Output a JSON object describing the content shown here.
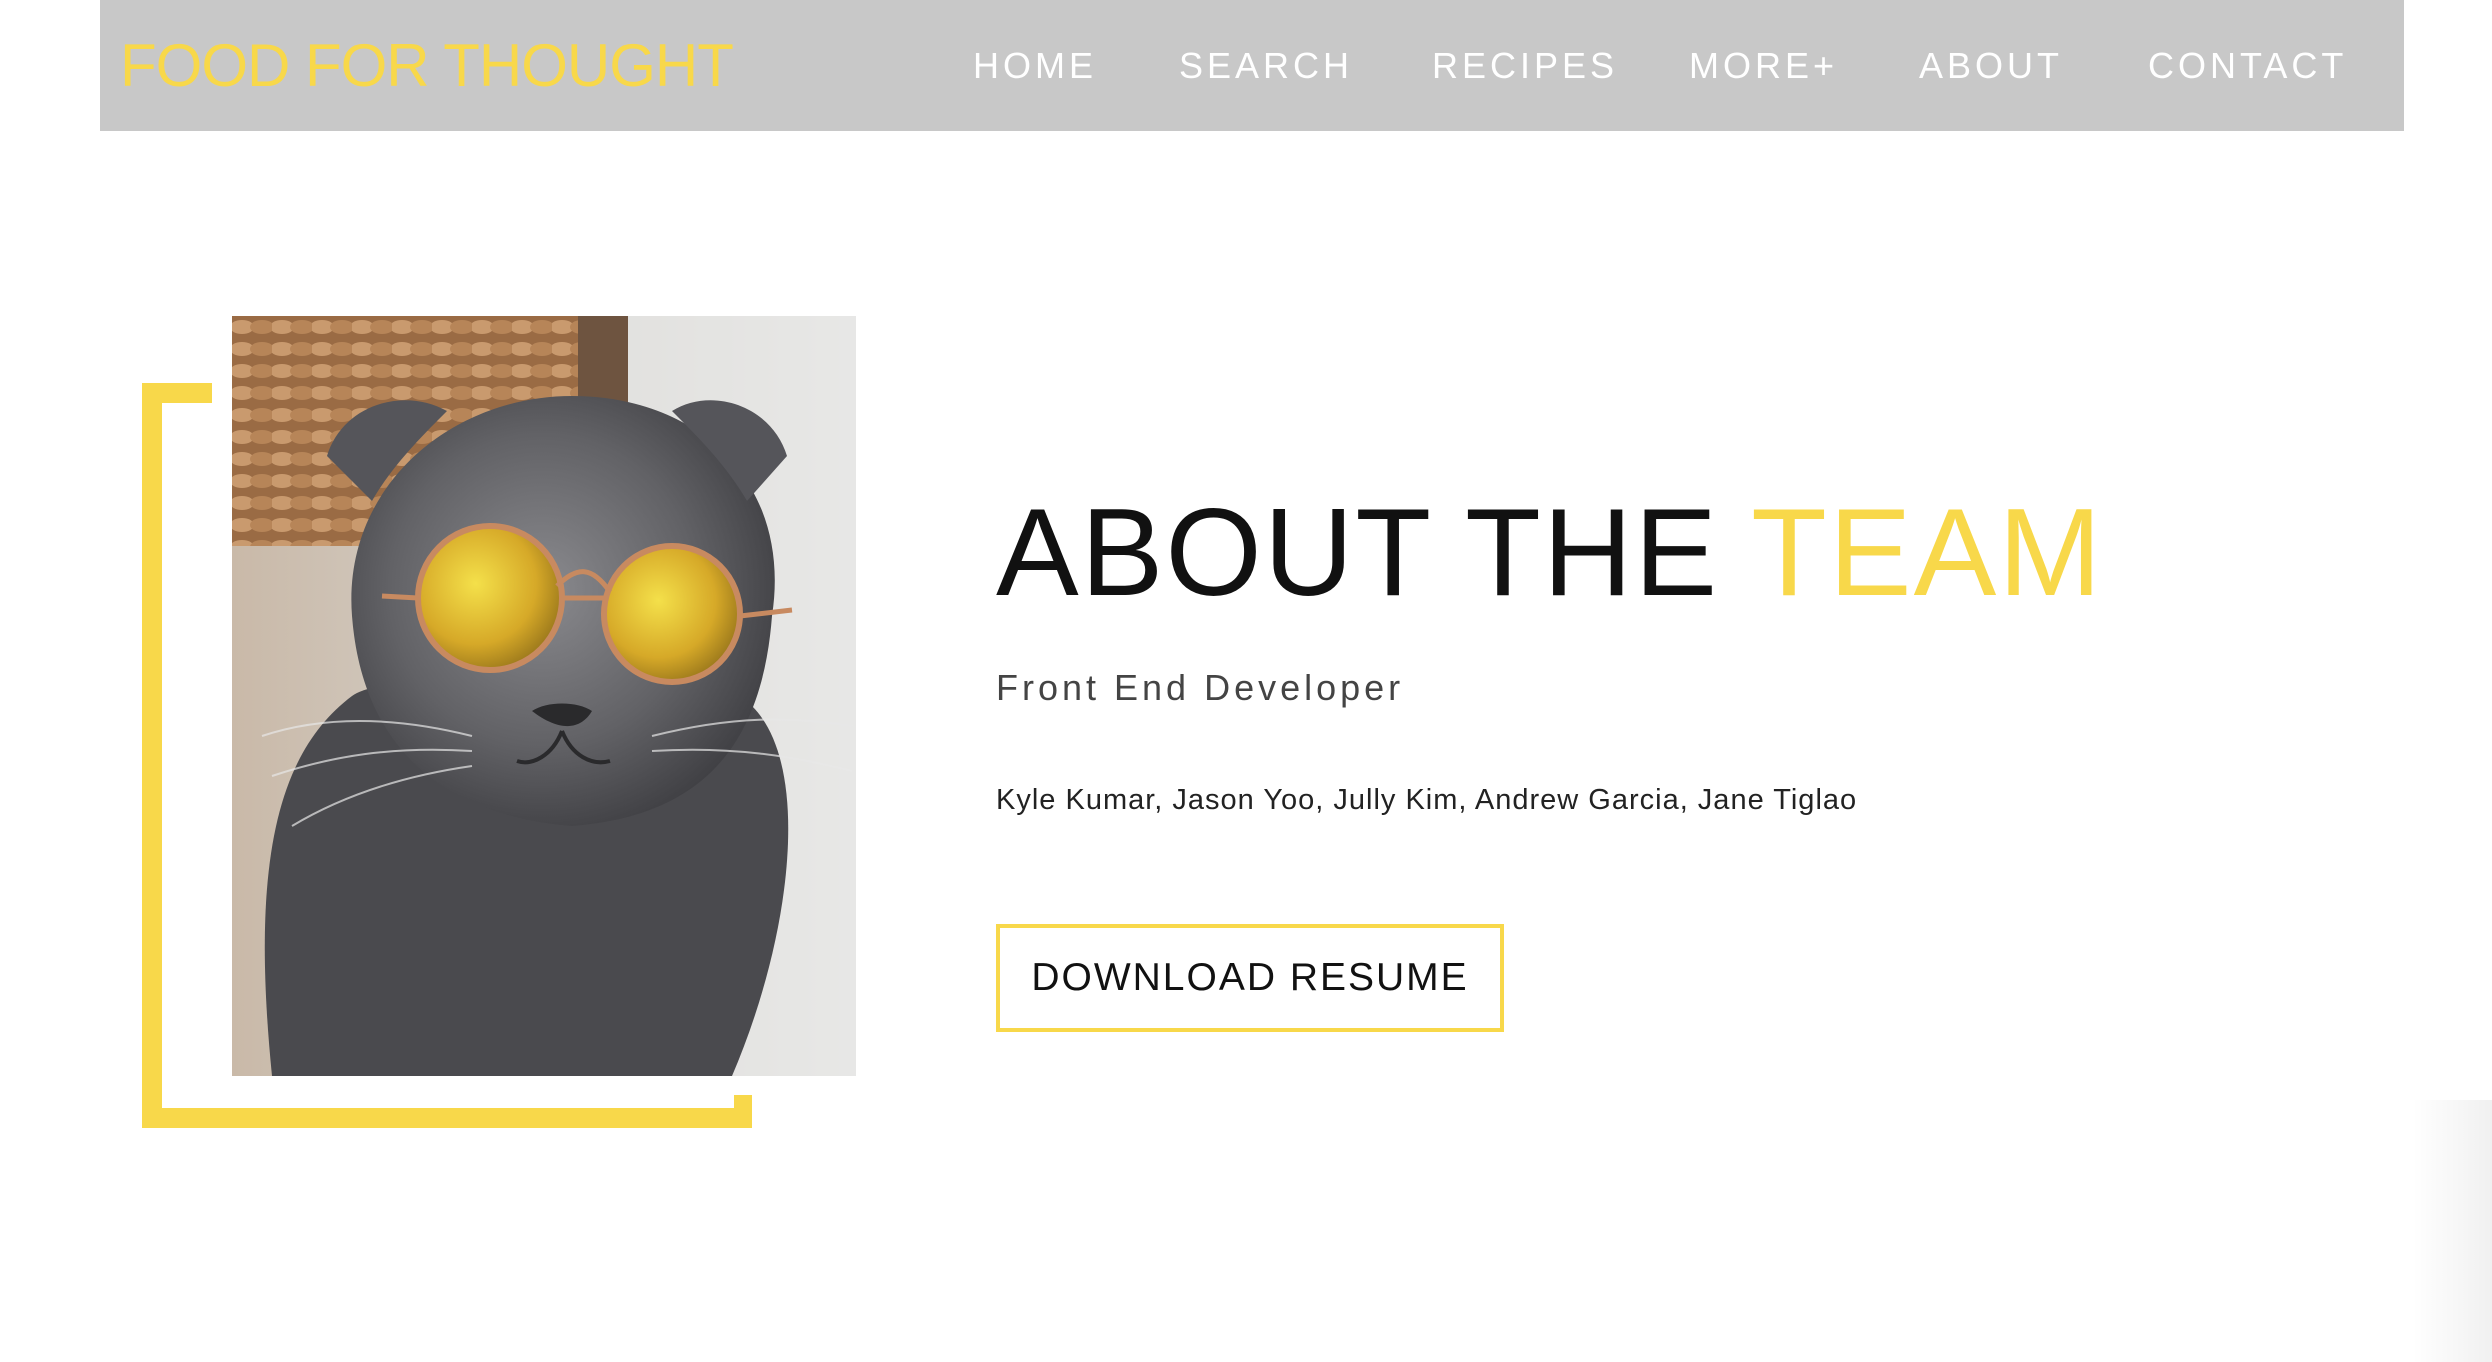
{
  "colors": {
    "accent": "#f8d84a",
    "navbar_bg": "#c8c8c8",
    "nav_text": "#ffffff",
    "heading_text": "#111111"
  },
  "navbar": {
    "brand": "FOOD FOR THOUGHT",
    "links": [
      {
        "label": "HOME"
      },
      {
        "label": "SEARCH"
      },
      {
        "label": "RECIPES"
      },
      {
        "label": "MORE+"
      },
      {
        "label": "ABOUT"
      },
      {
        "label": "CONTACT"
      }
    ]
  },
  "hero": {
    "photo_icon": "cat-with-sunglasses-photo",
    "title_main": "ABOUT THE",
    "title_accent": "TEAM",
    "role": "Front End Developer",
    "names": "Kyle Kumar, Jason Yoo, Jully Kim, Andrew Garcia, Jane Tiglao",
    "button_label": "DOWNLOAD RESUME"
  }
}
